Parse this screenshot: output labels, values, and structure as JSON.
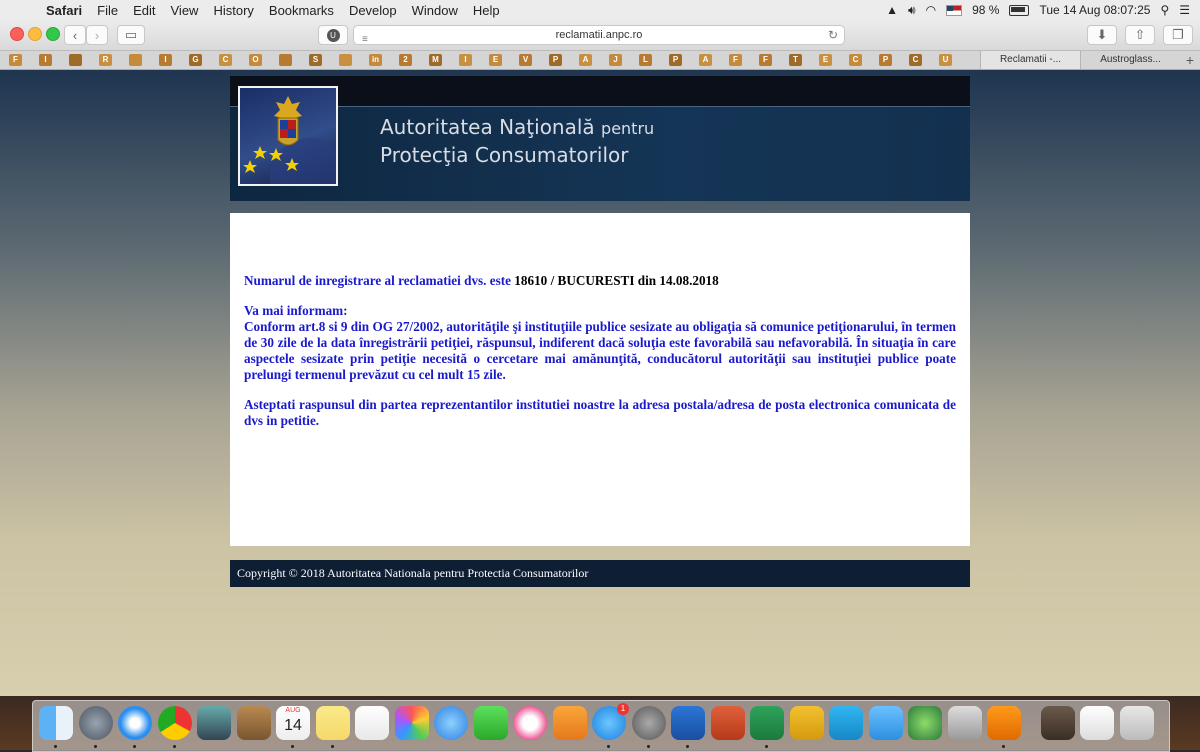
{
  "menubar": {
    "app": "Safari",
    "items": [
      "File",
      "Edit",
      "View",
      "History",
      "Bookmarks",
      "Develop",
      "Window",
      "Help"
    ],
    "battery": "98 %",
    "datetime": "Tue 14 Aug  08:07:25"
  },
  "toolbar": {
    "url": "reclamatii.anpc.ro",
    "ublock": "U"
  },
  "bookmarks": [
    "F",
    "I",
    "",
    "R",
    "",
    "I",
    "G",
    "C",
    "O",
    "",
    "S",
    "",
    "in",
    "2",
    "M",
    "I",
    "E",
    "V",
    "P",
    "A",
    "J",
    "L",
    "P",
    "A",
    "F",
    "F",
    "T",
    "E",
    "C",
    "P",
    "C",
    "U"
  ],
  "tabs": [
    {
      "label": "Reclamatii -..."
    },
    {
      "label": "Austroglass..."
    }
  ],
  "header": {
    "title_line1": "Autoritatea Naţională",
    "title_line1_small": "pentru",
    "title_line2": "Protecţia Consumatorilor"
  },
  "content": {
    "reg_prefix": "Numarul de inregistrare al reclamatiei dvs. este",
    "reg_value": "18610 / BUCURESTI din 14.08.2018",
    "info_heading": "Va mai informam:",
    "info_text": "Conform art.8 si 9 din OG 27/2002, autorităţile şi instituţiile publice sesizate au obligaţia să comunice petiţionarului, în termen de 30 zile de la data înregistrării petiţiei, răspunsul, indiferent dacă soluţia este favorabilă sau nefavorabilă. În situaţia în care aspectele sesizate prin petiţie necesită o cercetare mai amănunţită, conducătorul autorităţii sau instituţiei publice poate prelungi termenul prevăzut cu cel mult 15 zile.",
    "wait_text": "Asteptati raspunsul din partea reprezentantilor institutiei noastre la adresa postala/adresa de posta electronica comunicata de dvs in petitie."
  },
  "footer": {
    "copyright": "Copyright © 2018 Autoritatea Nationala pentru Protectia Consumatorilor"
  },
  "dock": {
    "calendar_month": "AUG",
    "calendar_day": "14",
    "appstore_badge": "1",
    "items": [
      "finder",
      "launchpad",
      "safari",
      "chrome",
      "preview",
      "contacts",
      "calendar",
      "notes",
      "reminders",
      "photos",
      "messages",
      "facetime",
      "itunes",
      "ibooks",
      "app-store",
      "system-preferences",
      "word",
      "powerpoint",
      "excel",
      "outlook",
      "skype",
      "messenger",
      "network",
      "chicken",
      "vlc",
      "documents",
      "chrome-app",
      "trash"
    ]
  }
}
